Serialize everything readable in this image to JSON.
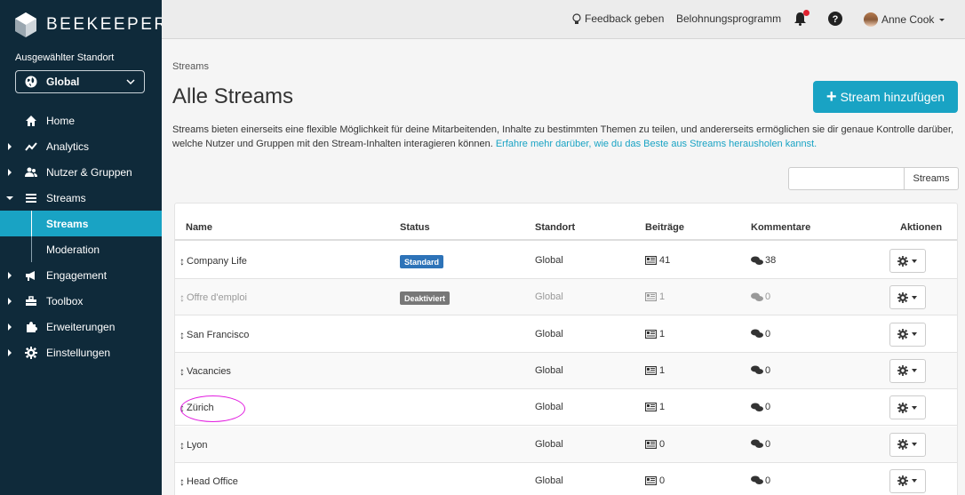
{
  "brand": {
    "name": "BEEKEEPER"
  },
  "location": {
    "label": "Ausgewählter Standort",
    "value": "Global"
  },
  "nav": {
    "home": "Home",
    "analytics": "Analytics",
    "users": "Nutzer & Gruppen",
    "streams": "Streams",
    "streams_sub": "Streams",
    "moderation": "Moderation",
    "engagement": "Engagement",
    "toolbox": "Toolbox",
    "extensions": "Erweiterungen",
    "settings": "Einstellungen"
  },
  "topbar": {
    "feedback": "Feedback geben",
    "rewards": "Belohnungsprogramm",
    "user": "Anne Cook"
  },
  "page": {
    "breadcrumb": "Streams",
    "title": "Alle Streams",
    "add_button": "Stream hinzufügen",
    "description": "Streams bieten einerseits eine flexible Möglichkeit für deine Mitarbeitenden, Inhalte zu bestimmten Themen zu teilen, und andererseits ermöglichen sie dir genaue Kontrolle darüber, welche Nutzer und Gruppen mit den Stream-Inhalten interagieren können.",
    "learn_more": "Erfahre mehr darüber, wie du das Beste aus Streams herausholen kannst.",
    "search_button": "Streams"
  },
  "table": {
    "headers": {
      "name": "Name",
      "status": "Status",
      "location": "Standort",
      "posts": "Beiträge",
      "comments": "Kommentare",
      "actions": "Aktionen"
    },
    "rows": [
      {
        "name": "Company Life",
        "status": "Standard",
        "location": "Global",
        "posts": "41",
        "comments": "38"
      },
      {
        "name": "Offre d'emploi",
        "status": "Deaktiviert",
        "location": "Global",
        "posts": "1",
        "comments": "0"
      },
      {
        "name": "San Francisco",
        "status": "",
        "location": "Global",
        "posts": "1",
        "comments": "0"
      },
      {
        "name": "Vacancies",
        "status": "",
        "location": "Global",
        "posts": "1",
        "comments": "0"
      },
      {
        "name": "Zürich",
        "status": "",
        "location": "Global",
        "posts": "1",
        "comments": "0"
      },
      {
        "name": "Lyon",
        "status": "",
        "location": "Global",
        "posts": "0",
        "comments": "0"
      },
      {
        "name": "Head Office",
        "status": "",
        "location": "Global",
        "posts": "0",
        "comments": "0"
      }
    ]
  },
  "colors": {
    "sidebar": "#0f2a3a",
    "accent": "#19a3c4",
    "standard_badge": "#2d73b8",
    "disabled_badge": "#777777",
    "highlight": "#e21ee0"
  }
}
